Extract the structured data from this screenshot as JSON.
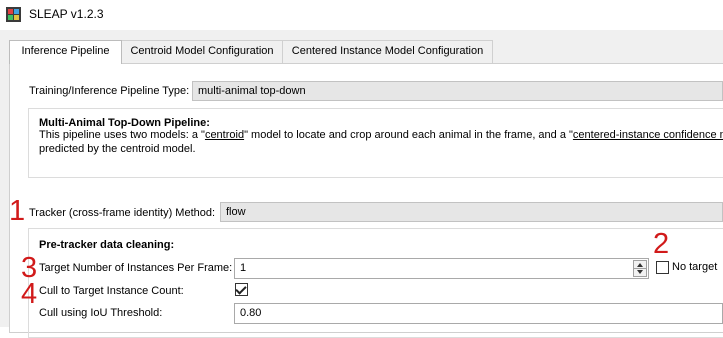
{
  "window": {
    "title": "SLEAP v1.2.3",
    "icon": "sleap-logo-icon"
  },
  "tabs": [
    {
      "label": "Inference Pipeline",
      "active": true
    },
    {
      "label": "Centroid Model Configuration",
      "active": false
    },
    {
      "label": "Centered Instance Model Configuration",
      "active": false
    }
  ],
  "pipeline": {
    "type_label": "Training/Inference Pipeline Type:",
    "type_value": "multi-animal top-down",
    "desc_title": "Multi-Animal Top-Down Pipeline:",
    "desc_pre": "This pipeline uses two models: a \"",
    "desc_link1": "centroid",
    "desc_mid": "\" model to locate and crop around each animal in the frame, and a \"",
    "desc_link2": "centered-instance confidence map",
    "desc_line2": "predicted by the centroid model."
  },
  "tracker": {
    "label": "Tracker (cross-frame identity) Method:",
    "value": "flow"
  },
  "pretracker": {
    "heading": "Pre-tracker data cleaning:",
    "target_label": "Target Number of Instances Per Frame:",
    "target_value": "1",
    "no_target_label": "No target",
    "no_target_checked": false,
    "cull_label": "Cull to Target Instance Count:",
    "cull_checked": true,
    "iou_label": "Cull using IoU Threshold:",
    "iou_value": "0.80"
  },
  "annotations": {
    "n1": "1",
    "n2": "2",
    "n3": "3",
    "n4": "4",
    "color": "#d11a1a"
  }
}
